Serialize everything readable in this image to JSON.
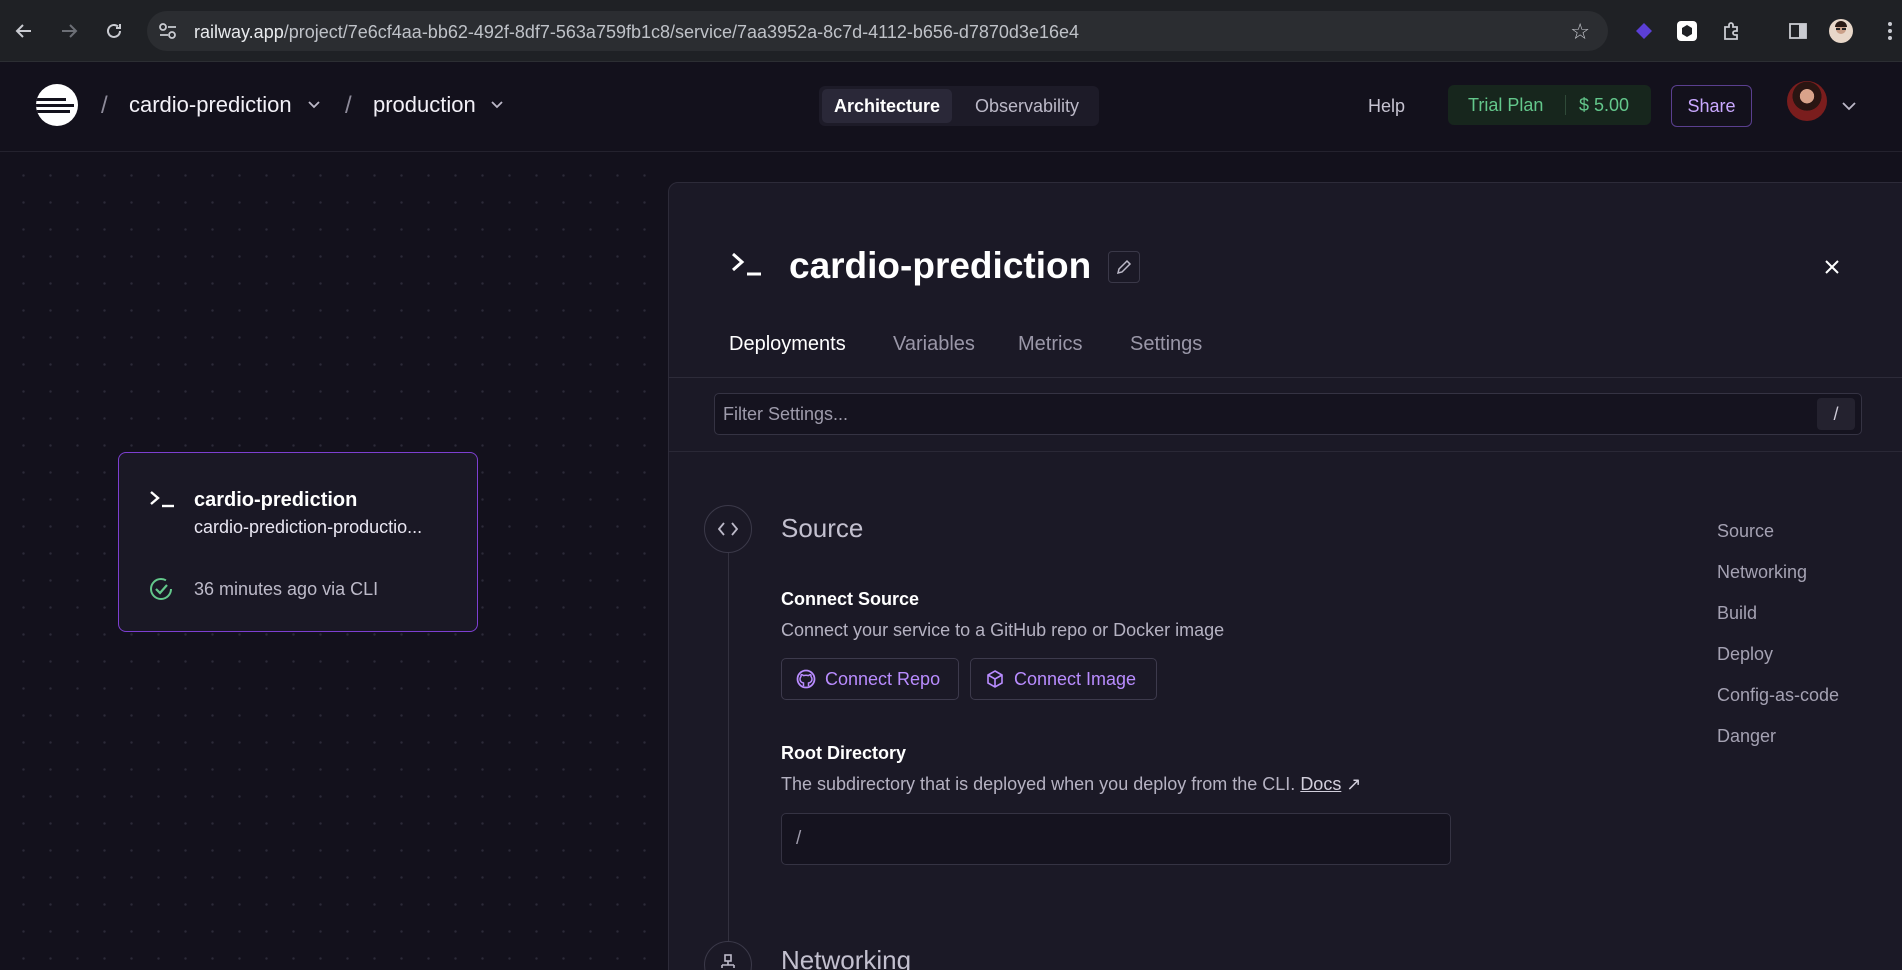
{
  "browser": {
    "url_domain": "railway.app",
    "url_path": "/project/7e6cf4aa-bb62-492f-8df7-563a759fb1c8/service/7aa3952a-8c7d-4112-b656-d7870d3e16e4"
  },
  "header": {
    "project": "cardio-prediction",
    "environment": "production",
    "view_tabs": [
      "Architecture",
      "Observability"
    ],
    "help": "Help",
    "plan": "Trial Plan",
    "credit": "$ 5.00",
    "share": "Share"
  },
  "canvas": {
    "service_card": {
      "name": "cardio-prediction",
      "domain": "cardio-prediction-productio...",
      "deploy_status": "36 minutes ago via CLI"
    }
  },
  "panel": {
    "title": "cardio-prediction",
    "tabs": [
      "Deployments",
      "Variables",
      "Metrics",
      "Settings"
    ],
    "active_tab": "Deployments",
    "filter_placeholder": "Filter Settings...",
    "filter_shortcut": "/",
    "source": {
      "title": "Source",
      "connect_label": "Connect Source",
      "connect_desc": "Connect your service to a GitHub repo or Docker image",
      "connect_repo": "Connect Repo",
      "connect_image": "Connect Image",
      "root_label": "Root Directory",
      "root_desc": "The subdirectory that is deployed when you deploy from the CLI.",
      "root_docs": "Docs",
      "root_value": "/"
    },
    "networking_title": "Networking",
    "toc": [
      "Source",
      "Networking",
      "Build",
      "Deploy",
      "Config-as-code",
      "Danger"
    ]
  },
  "colors": {
    "accent": "#b98cff",
    "card_border": "#7d3fd1",
    "success": "#63c78b"
  }
}
